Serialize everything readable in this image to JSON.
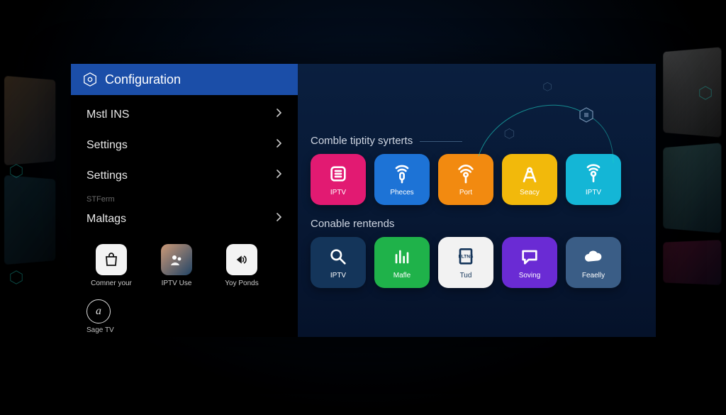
{
  "header": {
    "title": "Configuration"
  },
  "menu": {
    "items": [
      {
        "label": "Mstl INS"
      },
      {
        "label": "Settings"
      },
      {
        "label": "Settings"
      }
    ],
    "subheader": "STFerm",
    "lastItem": {
      "label": "Maltags"
    }
  },
  "apps": [
    {
      "name": "comner",
      "label": "Comner your"
    },
    {
      "name": "iptv-use",
      "label": "IPTV Use"
    },
    {
      "name": "yoy-ponds",
      "label": "Yoy Ponds"
    }
  ],
  "sage": {
    "label": "Sage TV",
    "glyph": "a"
  },
  "sections": [
    {
      "title": "Comble tiptity syrterts",
      "tiles": [
        {
          "name": "iptv1",
          "label": "IPTV",
          "color": "#e21a72",
          "icon": "list"
        },
        {
          "name": "pheces",
          "label": "Pheces",
          "color": "#1d73d6",
          "icon": "mic"
        },
        {
          "name": "port",
          "label": "Port",
          "color": "#f28a10",
          "icon": "antenna"
        },
        {
          "name": "seacy",
          "label": "Seacy",
          "color": "#f2b90b",
          "icon": "compass"
        },
        {
          "name": "iptv2",
          "label": "IPTV",
          "color": "#14b6d6",
          "icon": "mic2"
        }
      ]
    },
    {
      "title": "Conable rentends",
      "tiles": [
        {
          "name": "iptv3",
          "label": "IPTV",
          "color": "#14355a",
          "icon": "search"
        },
        {
          "name": "mafle",
          "label": "Mafle",
          "color": "#1fb24a",
          "icon": "bars"
        },
        {
          "name": "tud",
          "label": "Tud",
          "color": "#f2f2f2",
          "icon": "flns",
          "text": "FLTNS"
        },
        {
          "name": "soving",
          "label": "Soving",
          "color": "#6a2bd4",
          "icon": "chat"
        },
        {
          "name": "feaelly",
          "label": "Feaelly",
          "color": "#3a5d86",
          "icon": "cloud"
        }
      ]
    }
  ]
}
